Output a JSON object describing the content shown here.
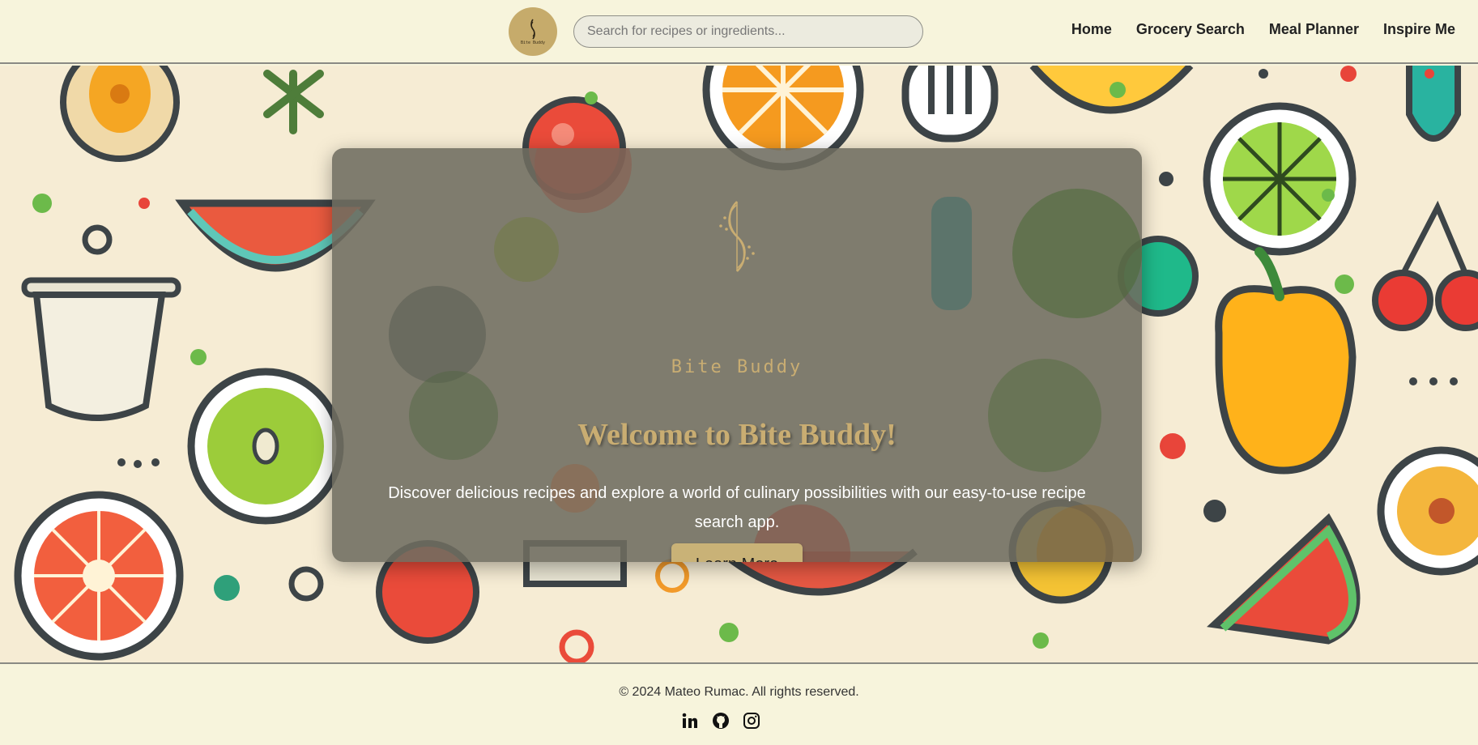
{
  "header": {
    "logo_text": "Bite Buddy",
    "search_placeholder": "Search for recipes or ingredients...",
    "nav": [
      {
        "label": "Home"
      },
      {
        "label": "Grocery Search"
      },
      {
        "label": "Meal Planner"
      },
      {
        "label": "Inspire Me"
      }
    ]
  },
  "hero": {
    "brand": "Bite Buddy",
    "title": "Welcome to Bite Buddy!",
    "description": "Discover delicious recipes and explore a world of culinary possibilities with our easy-to-use recipe search app.",
    "cta_label": "Learn More"
  },
  "footer": {
    "copyright": "© 2024 Mateo Rumac. All rights reserved.",
    "social_icons": [
      "linkedin-icon",
      "github-icon",
      "instagram-icon"
    ]
  },
  "colors": {
    "background": "#f7f4dc",
    "accent_gold": "#c9ad72",
    "button": "#c9b277",
    "card_overlay": "#6e6c60"
  }
}
